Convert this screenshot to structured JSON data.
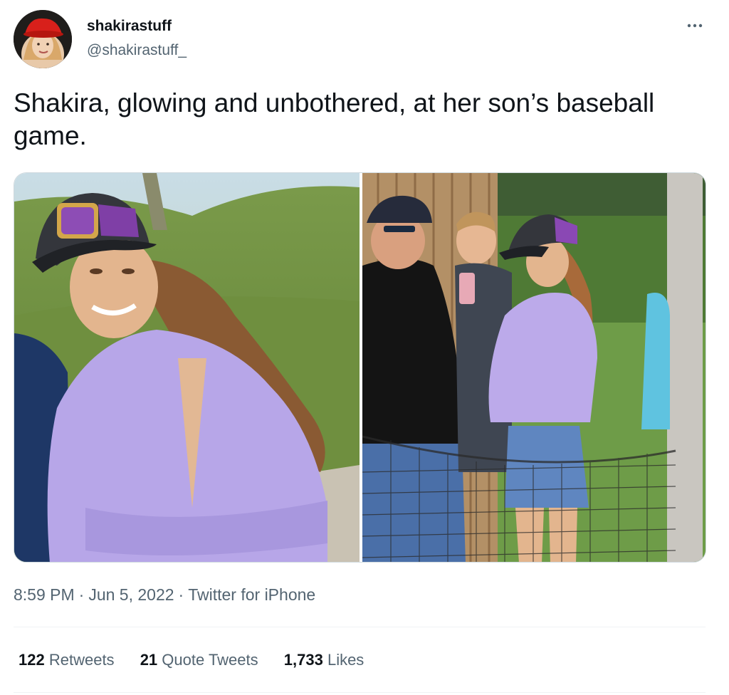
{
  "author": {
    "display_name": "shakirastuff",
    "handle": "@shakirastuff_"
  },
  "tweet": {
    "text": "Shakira, glowing and unbothered, at her son’s baseball game."
  },
  "media": {
    "count": 2
  },
  "meta": {
    "time": "8:59 PM",
    "date": "Jun 5, 2022",
    "source": "Twitter for iPhone",
    "separator": "·"
  },
  "stats": {
    "retweets_count": "122",
    "retweets_label": "Retweets",
    "quotes_count": "21",
    "quotes_label": "Quote Tweets",
    "likes_count": "1,733",
    "likes_label": "Likes"
  },
  "icons": {
    "more": "more-horizontal-icon"
  },
  "colors": {
    "text_primary": "#0f1419",
    "text_secondary": "#536471",
    "divider": "#eff3f4"
  }
}
